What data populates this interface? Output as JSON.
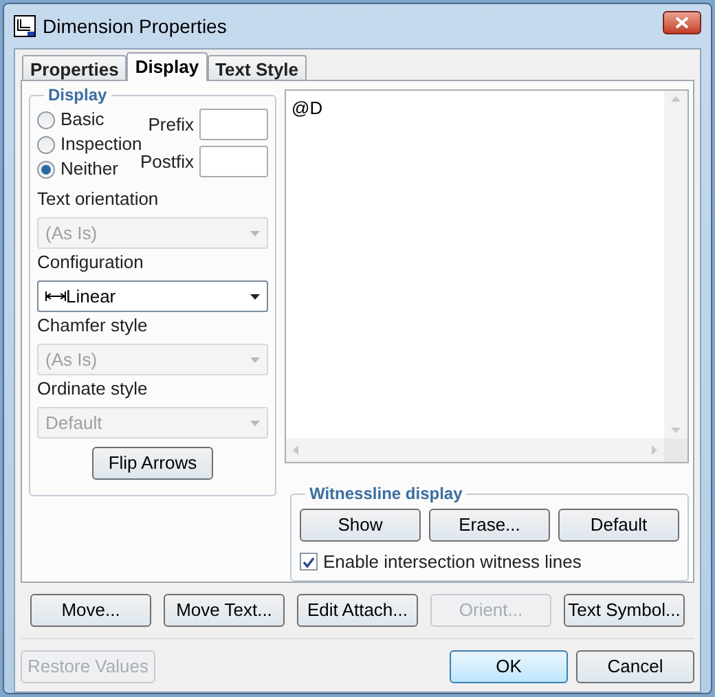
{
  "window": {
    "title": "Dimension Properties"
  },
  "tabs": [
    {
      "label": "Properties",
      "selected": false
    },
    {
      "label": "Display",
      "selected": true
    },
    {
      "label": "Text Style",
      "selected": false
    }
  ],
  "display_group": {
    "title": "Display",
    "radios": [
      {
        "label": "Basic",
        "selected": false
      },
      {
        "label": "Inspection",
        "selected": false
      },
      {
        "label": "Neither",
        "selected": true
      }
    ],
    "prefix": {
      "label": "Prefix"
    },
    "postfix": {
      "label": "Postfix"
    },
    "dropdowns": [
      {
        "label": "Text orientation",
        "value": "(As Is)",
        "disabled": true,
        "has_icon": false
      },
      {
        "label": "Configuration",
        "value": "Linear",
        "disabled": false,
        "has_icon": true
      },
      {
        "label": "Chamfer style",
        "value": "(As Is)",
        "disabled": true,
        "has_icon": false
      },
      {
        "label": "Ordinate style",
        "value": "Default",
        "disabled": true,
        "has_icon": false
      }
    ],
    "flip_button": "Flip Arrows"
  },
  "text_area": {
    "value": "@D"
  },
  "witnessline": {
    "title": "Witnessline display",
    "buttons": [
      "Show",
      "Erase...",
      "Default"
    ],
    "checkbox": {
      "label": "Enable intersection witness lines",
      "checked": true
    }
  },
  "action_buttons": [
    {
      "label": "Move...",
      "disabled": false
    },
    {
      "label": "Move Text...",
      "disabled": false
    },
    {
      "label": "Edit Attach...",
      "disabled": false
    },
    {
      "label": "Orient...",
      "disabled": true
    },
    {
      "label": "Text Symbol...",
      "disabled": false
    }
  ],
  "footer_buttons": [
    {
      "label": "Restore Values",
      "disabled": true,
      "default": false
    },
    {
      "label": "OK",
      "disabled": false,
      "default": true
    },
    {
      "label": "Cancel",
      "disabled": false,
      "default": false
    }
  ]
}
